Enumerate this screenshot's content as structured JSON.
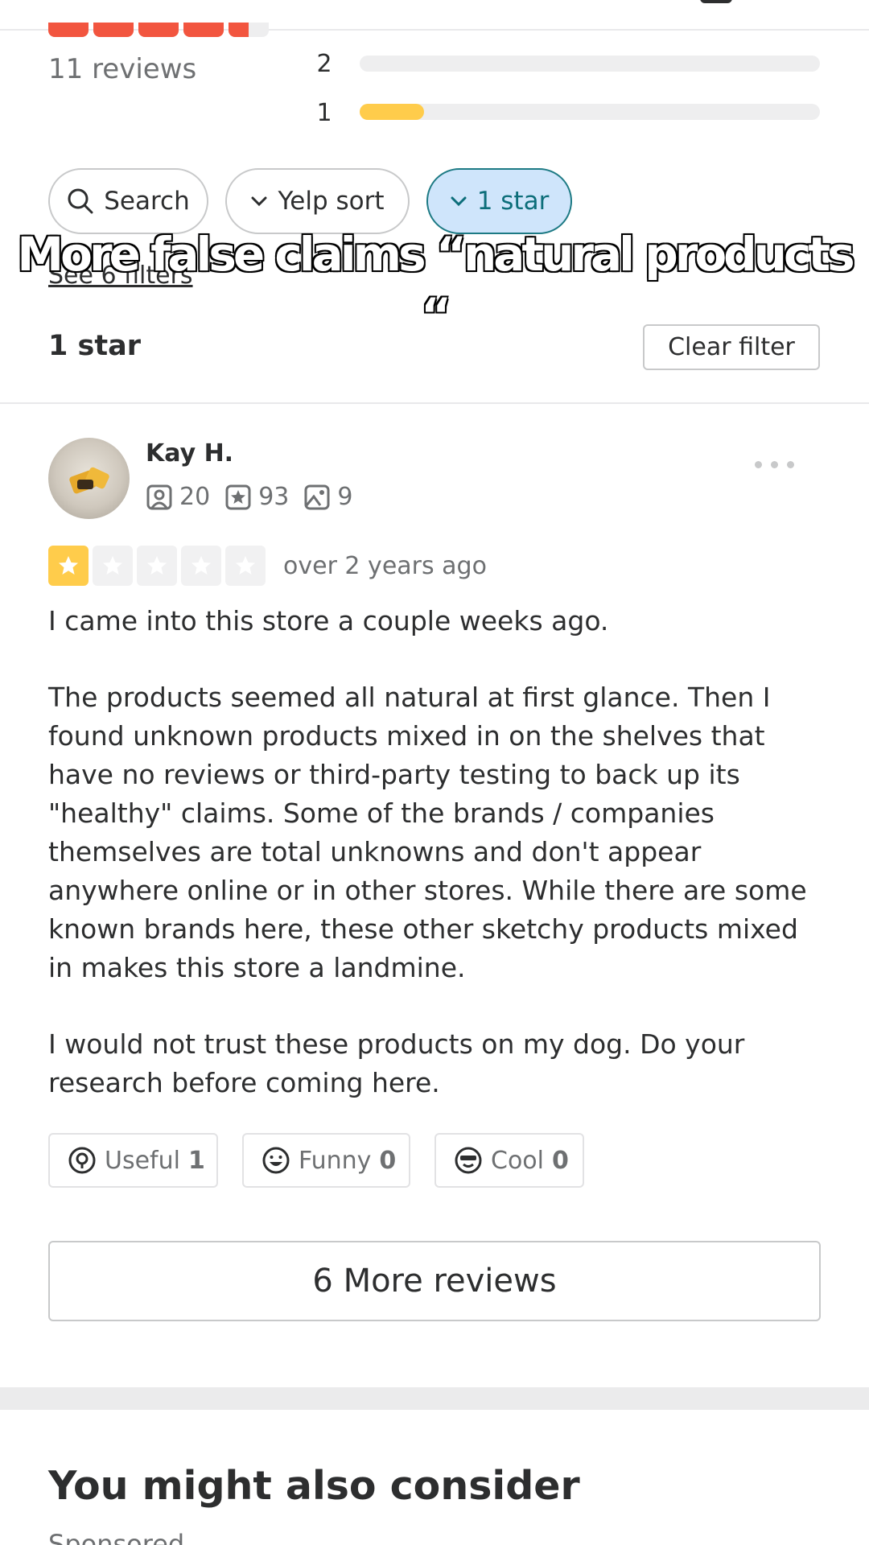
{
  "summary": {
    "reviews_count": "11 reviews",
    "bars": [
      {
        "label": "2",
        "fill_fraction": 0.0
      },
      {
        "label": "1",
        "fill_fraction": 0.14
      }
    ],
    "colors": {
      "star_red": "#f2553f",
      "bar_yellow": "#ffcc4b"
    }
  },
  "filters": {
    "search_label": "Search",
    "sort_label": "Yelp sort",
    "star_label": "1 star",
    "see_filters": "See 6 filters"
  },
  "caption": {
    "line1": "More false claims “natural products",
    "line2": "“"
  },
  "filter_section": {
    "title": "1 star",
    "clear_label": "Clear filter"
  },
  "review": {
    "user_name": "Kay H.",
    "stats": {
      "friends": "20",
      "reviews": "93",
      "photos": "9"
    },
    "rating": 1,
    "rating_max": 5,
    "date": "over 2 years ago",
    "paragraphs": [
      "I came into this store a couple weeks ago.",
      "The products seemed all natural at first glance.  Then I found unknown products mixed in on the shelves that have no reviews or third-party testing to back up its \"healthy\" claims. Some of the brands / companies themselves are total unknowns and don't appear anywhere online or in other stores. While there are some known brands here, these other sketchy products mixed in makes this store a landmine.",
      "I would not trust these products on my dog. Do your research before coming here."
    ],
    "reactions": {
      "useful_label": "Useful",
      "useful_count": "1",
      "funny_label": "Funny",
      "funny_count": "0",
      "cool_label": "Cool",
      "cool_count": "0"
    }
  },
  "more_reviews_label": "6 More reviews",
  "consider": {
    "title": "You might also consider",
    "sponsored": "Sponsored"
  }
}
